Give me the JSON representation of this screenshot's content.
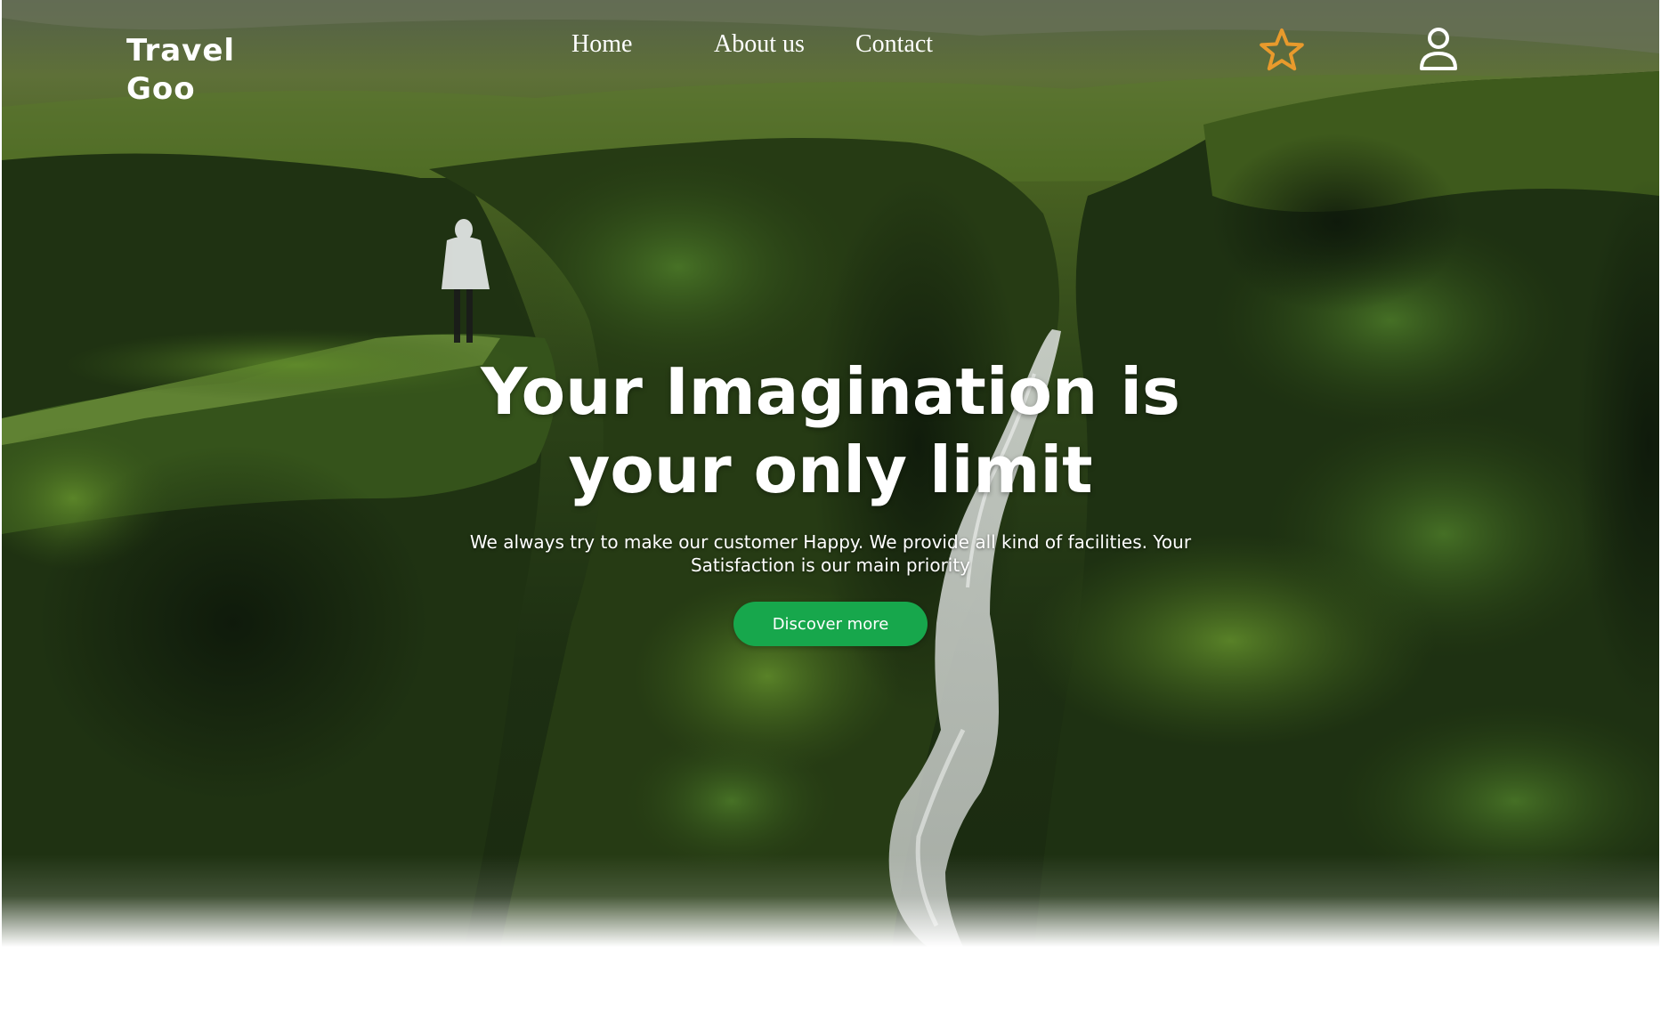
{
  "brand": {
    "line1": "Travel",
    "line2": "Goo"
  },
  "nav": {
    "items": [
      {
        "label": "Home"
      },
      {
        "label": "About us"
      },
      {
        "label": "Contact"
      }
    ]
  },
  "icons": {
    "favorites": "star-icon",
    "account": "user-icon"
  },
  "hero": {
    "headline_line1": "Your Imagination is",
    "headline_line2": "your only limit",
    "subtext": "We always try to make our customer Happy. We provide all kind of facilities. Your Satisfaction is our main priority",
    "cta_label": "Discover more"
  },
  "colors": {
    "cta": "#17a74c",
    "star": "#e89a2c",
    "text": "#ffffff",
    "foliage": "#2f4a1c"
  }
}
